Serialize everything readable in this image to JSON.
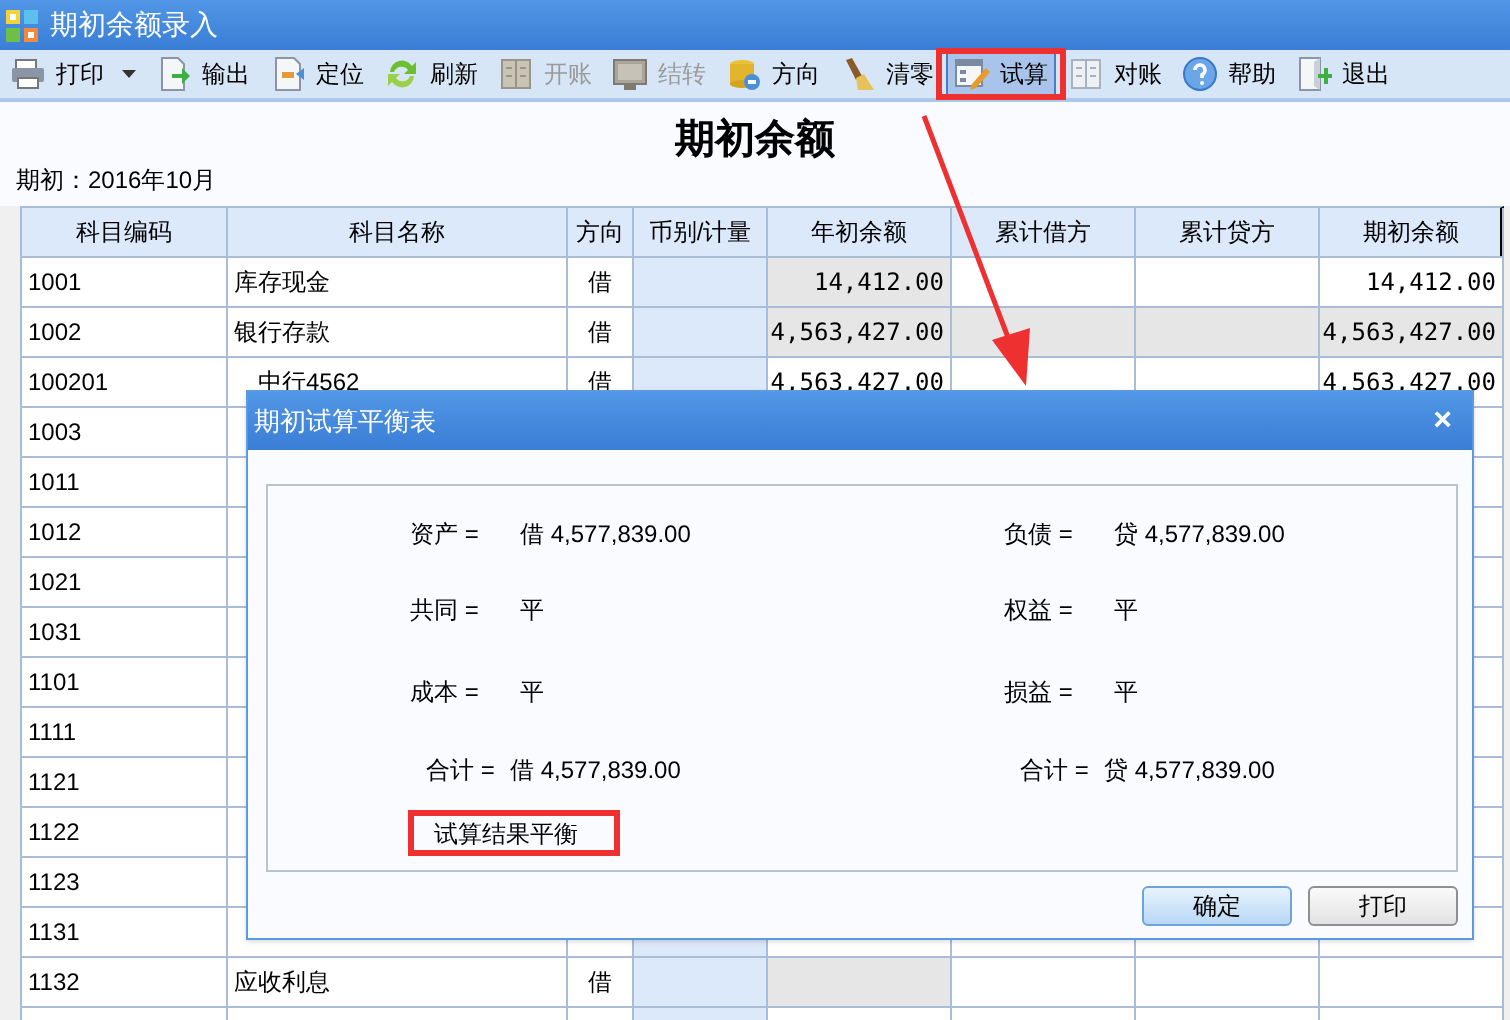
{
  "window": {
    "title": "期初余额录入"
  },
  "toolbar": [
    {
      "label": "打印",
      "disabled": false,
      "selected": false,
      "dropdown": true
    },
    {
      "label": "输出",
      "disabled": false,
      "selected": false,
      "dropdown": false
    },
    {
      "label": "定位",
      "disabled": false,
      "selected": false,
      "dropdown": false
    },
    {
      "label": "刷新",
      "disabled": false,
      "selected": false,
      "dropdown": false
    },
    {
      "label": "开账",
      "disabled": true,
      "selected": false,
      "dropdown": false
    },
    {
      "label": "结转",
      "disabled": true,
      "selected": false,
      "dropdown": false
    },
    {
      "label": "方向",
      "disabled": false,
      "selected": false,
      "dropdown": false
    },
    {
      "label": "清零",
      "disabled": false,
      "selected": false,
      "dropdown": false
    },
    {
      "label": "试算",
      "disabled": false,
      "selected": true,
      "dropdown": false
    },
    {
      "label": "对账",
      "disabled": false,
      "selected": false,
      "dropdown": false
    },
    {
      "label": "帮助",
      "disabled": false,
      "selected": false,
      "dropdown": false
    },
    {
      "label": "退出",
      "disabled": false,
      "selected": false,
      "dropdown": false
    }
  ],
  "report": {
    "title": "期初余额",
    "period": "期初：2016年10月"
  },
  "table": {
    "columns": [
      "科目编码",
      "科目名称",
      "方向",
      "币别/计量",
      "年初余额",
      "累计借方",
      "累计贷方",
      "期初余额"
    ],
    "rows": [
      {
        "code": "1001",
        "name": "库存现金",
        "direction": "借",
        "year_opening": "14,412.00",
        "opening": "14,412.00",
        "locked": true,
        "selected": false
      },
      {
        "code": "1002",
        "name": "银行存款",
        "direction": "借",
        "year_opening": "4,563,427.00",
        "opening": "4,563,427.00",
        "locked": true,
        "selected": true
      },
      {
        "code": "100201",
        "name": "中行4562",
        "direction": "借",
        "year_opening": "4,563,427.00",
        "opening": "4,563,427.00",
        "locked": false,
        "selected": false,
        "indent": true
      },
      {
        "code": "1003"
      },
      {
        "code": "1011"
      },
      {
        "code": "1012"
      },
      {
        "code": "1021"
      },
      {
        "code": "1031"
      },
      {
        "code": "1101"
      },
      {
        "code": "1111"
      },
      {
        "code": "1121"
      },
      {
        "code": "1122"
      },
      {
        "code": "1123"
      },
      {
        "code": "1131",
        "locked": false,
        "selected": false
      },
      {
        "code": "1132",
        "name": "应收利息",
        "direction": "借",
        "locked": true,
        "selected": false
      }
    ]
  },
  "dialog": {
    "title": "期初试算平衡表",
    "close": "×",
    "left": [
      {
        "label": "资产 =",
        "value": "借 4,577,839.00"
      },
      {
        "label": "共同 =",
        "value": "平"
      },
      {
        "label": "成本 =",
        "value": "平"
      },
      {
        "label": "合计 =",
        "value": "借 4,577,839.00"
      }
    ],
    "right": [
      {
        "label": "负债 =",
        "value": "贷 4,577,839.00"
      },
      {
        "label": "权益 =",
        "value": "平"
      },
      {
        "label": "损益 =",
        "value": "平"
      },
      {
        "label": "合计 =",
        "value": "贷 4,577,839.00"
      }
    ],
    "result": "试算结果平衡",
    "buttons": [
      {
        "label": "确定",
        "default": true
      },
      {
        "label": "打印",
        "default": false
      }
    ]
  }
}
